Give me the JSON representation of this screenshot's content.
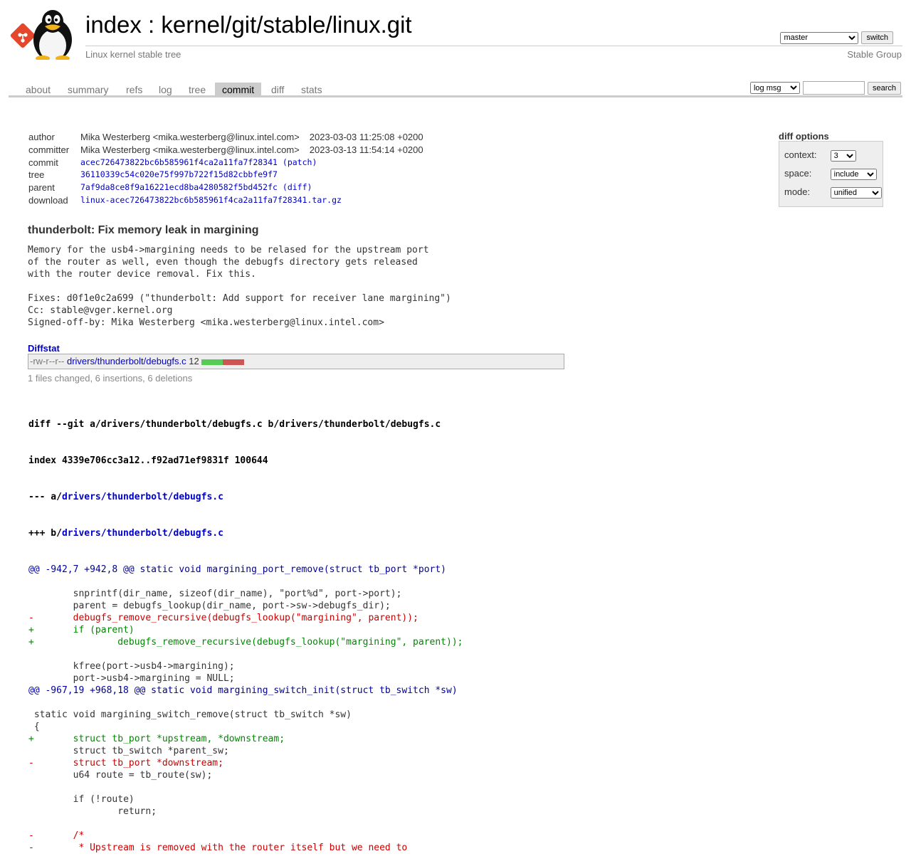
{
  "header": {
    "title": "index : kernel/git/stable/linux.git",
    "subtitle": "Linux kernel stable tree",
    "owner": "Stable Group",
    "branch_selected": "master",
    "switch_label": "switch"
  },
  "tabs": [
    {
      "label": "about",
      "active": false
    },
    {
      "label": "summary",
      "active": false
    },
    {
      "label": "refs",
      "active": false
    },
    {
      "label": "log",
      "active": false
    },
    {
      "label": "tree",
      "active": false
    },
    {
      "label": "commit",
      "active": true
    },
    {
      "label": "diff",
      "active": false
    },
    {
      "label": "stats",
      "active": false
    }
  ],
  "search": {
    "select_value": "log msg",
    "button_label": "search"
  },
  "commit_info": {
    "author_label": "author",
    "author": "Mika Westerberg <mika.westerberg@linux.intel.com>",
    "author_date": "2023-03-03 11:25:08 +0200",
    "committer_label": "committer",
    "committer": "Mika Westerberg <mika.westerberg@linux.intel.com>",
    "committer_date": "2023-03-13 11:54:14 +0200",
    "commit_label": "commit",
    "commit_hash": "acec726473822bc6b585961f4ca2a11fa7f28341",
    "commit_extra": "patch",
    "tree_label": "tree",
    "tree_hash": "36110339c54c020e75f997b722f15d82cbbfe9f7",
    "parent_label": "parent",
    "parent_hash": "7af9da8ce8f9a16221ecd8ba4280582f5bd452fc",
    "parent_extra": "diff",
    "download_label": "download",
    "download_file": "linux-acec726473822bc6b585961f4ca2a11fa7f28341.tar.gz"
  },
  "diff_options": {
    "title": "diff options",
    "context_label": "context:",
    "context_value": "3",
    "space_label": "space:",
    "space_value": "include",
    "mode_label": "mode:",
    "mode_value": "unified"
  },
  "message": {
    "subject": "thunderbolt: Fix memory leak in margining",
    "body": "Memory for the usb4->margining needs to be relased for the upstream port\nof the router as well, even though the debugfs directory gets released\nwith the router device removal. Fix this.\n\nFixes: d0f1e0c2a699 (\"thunderbolt: Add support for receiver lane margining\")\nCc: stable@vger.kernel.org\nSigned-off-by: Mika Westerberg <mika.westerberg@linux.intel.com>"
  },
  "diffstat": {
    "title": "Diffstat",
    "mode": "-rw-r--r--",
    "file": "drivers/thunderbolt/debugfs.c",
    "changes": "12",
    "summary": "1 files changed, 6 insertions, 6 deletions"
  },
  "diff": {
    "header_line": "diff --git a/drivers/thunderbolt/debugfs.c b/drivers/thunderbolt/debugfs.c",
    "index_line": "index 4339e706cc3a12..f92ad71ef9831f 100644",
    "minus_prefix": "--- a/",
    "plus_prefix": "+++ b/",
    "file_path": "drivers/thunderbolt/debugfs.c",
    "lines": [
      {
        "type": "hunk",
        "text": "@@ -942,7 +942,8 @@ static void margining_port_remove(struct tb_port *port)"
      },
      {
        "type": "ctx",
        "text": " "
      },
      {
        "type": "ctx",
        "text": " \tsnprintf(dir_name, sizeof(dir_name), \"port%d\", port->port);"
      },
      {
        "type": "ctx",
        "text": " \tparent = debugfs_lookup(dir_name, port->sw->debugfs_dir);"
      },
      {
        "type": "del",
        "text": "-\tdebugfs_remove_recursive(debugfs_lookup(\"margining\", parent));"
      },
      {
        "type": "add",
        "text": "+\tif (parent)"
      },
      {
        "type": "add",
        "text": "+\t\tdebugfs_remove_recursive(debugfs_lookup(\"margining\", parent));"
      },
      {
        "type": "ctx",
        "text": " "
      },
      {
        "type": "ctx",
        "text": " \tkfree(port->usb4->margining);"
      },
      {
        "type": "ctx",
        "text": " \tport->usb4->margining = NULL;"
      },
      {
        "type": "hunk",
        "text": "@@ -967,19 +968,18 @@ static void margining_switch_init(struct tb_switch *sw)"
      },
      {
        "type": "ctx",
        "text": " "
      },
      {
        "type": "ctx",
        "text": " static void margining_switch_remove(struct tb_switch *sw)"
      },
      {
        "type": "ctx",
        "text": " {"
      },
      {
        "type": "add",
        "text": "+\tstruct tb_port *upstream, *downstream;"
      },
      {
        "type": "ctx",
        "text": " \tstruct tb_switch *parent_sw;"
      },
      {
        "type": "del",
        "text": "-\tstruct tb_port *downstream;"
      },
      {
        "type": "ctx",
        "text": " \tu64 route = tb_route(sw);"
      },
      {
        "type": "ctx",
        "text": " "
      },
      {
        "type": "ctx",
        "text": " \tif (!route)"
      },
      {
        "type": "ctx",
        "text": " \t\treturn;"
      },
      {
        "type": "ctx",
        "text": " "
      },
      {
        "type": "del",
        "text": "-\t/*"
      },
      {
        "type": "del",
        "text": "-\t * Upstream is removed with the router itself but we need to"
      }
    ]
  }
}
